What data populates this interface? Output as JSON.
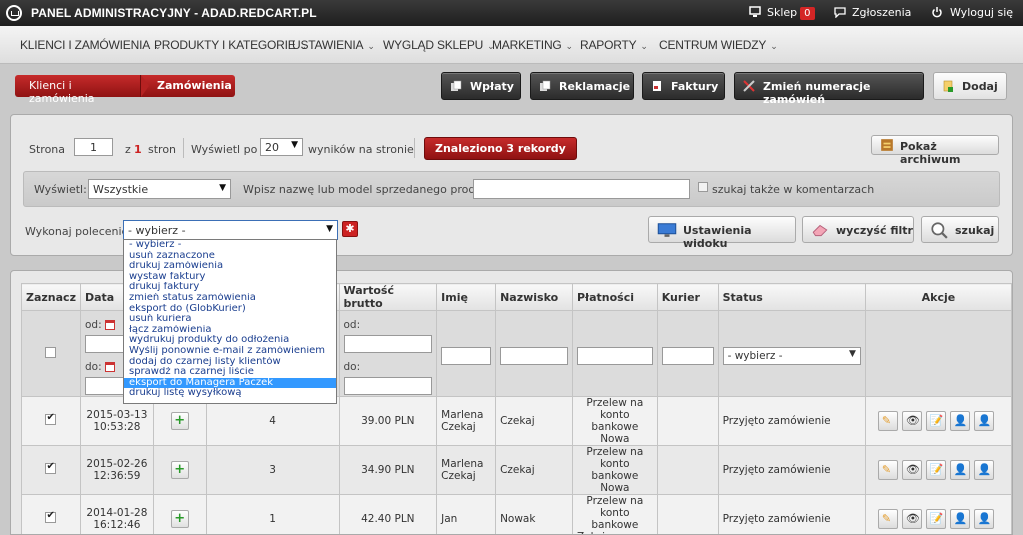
{
  "topbar": {
    "title": "PANEL ADMINISTRACYJNY - ADAD.REDCART.PL",
    "shop_label": "Sklep",
    "shop_badge": "0",
    "reports_label": "Zgłoszenia",
    "logout_label": "Wyloguj się"
  },
  "nav": {
    "items": [
      {
        "label": "KLIENCI I ZAMÓWIENIA"
      },
      {
        "label": "PRODUKTY I KATEGORIE"
      },
      {
        "label": "USTAWIENIA"
      },
      {
        "label": "WYGLĄD SKLEPU"
      },
      {
        "label": "MARKETING"
      },
      {
        "label": "RAPORTY"
      },
      {
        "label": "CENTRUM WIEDZY"
      }
    ]
  },
  "breadcrumb": {
    "parent": "Klienci i zamówienia",
    "current": "Zamówienia"
  },
  "toolbar": {
    "payments": "Wpłaty",
    "complaints": "Reklamacje",
    "invoices": "Faktury",
    "renumber": "Zmień numeracje zamówień",
    "add": "Dodaj"
  },
  "filters": {
    "page_label": "Strona",
    "page_value": "1",
    "of_label": "z",
    "of_total": "1",
    "pages_label": "stron",
    "show_label": "Wyświetl po",
    "show_value": "20",
    "results_label": "wyników na stronie",
    "found_label": "Znaleziono 3 rekordy",
    "archive_label": "Pokaż archiwum",
    "display_label": "Wyświetl:",
    "display_value": "Wszystkie",
    "product_label": "Wpisz nazwę lub model sprzedanego produktu:",
    "product_value": "",
    "comments_label": "szukaj także w komentarzach",
    "command_label": "Wykonaj polecenie:",
    "command_value": "- wybierz -",
    "view_settings": "Ustawienia widoku",
    "clear_filter": "wyczyść filtr",
    "search": "szukaj"
  },
  "command_options": [
    "- wybierz -",
    "usuń zaznaczone",
    "drukuj zamówienia",
    "wystaw faktury",
    "drukuj faktury",
    "zmień status zamówienia",
    "eksport do (GlobKurier)",
    "usuń kuriera",
    "łącz zamówienia",
    "wydrukuj produkty do odłożenia",
    "Wyślij ponownie e-mail z zamówieniem",
    "dodaj do czarnej listy klientów",
    "sprawdź na czarnej liście",
    "eksport do Managera Paczek",
    "drukuj listę wysyłkową"
  ],
  "command_selected_index": 13,
  "table": {
    "headers": {
      "select": "Zaznacz",
      "date": "Data",
      "value": "Wartość brutto",
      "first_name": "Imię",
      "last_name": "Nazwisko",
      "payment": "Płatności",
      "courier": "Kurier",
      "status": "Status",
      "actions": "Akcje"
    },
    "filter": {
      "from_label": "od:",
      "to_label": "do:",
      "status_value": "- wybierz -"
    },
    "rows": [
      {
        "date": "2015-03-13",
        "time": "10:53:28",
        "items": "4",
        "value": "39.00 PLN",
        "first_name": "Marlena Czekaj",
        "last_name": "Czekaj",
        "payment": "Przelew na konto bankowe Nowa",
        "status": "Przyjęto zamówienie"
      },
      {
        "date": "2015-02-26",
        "time": "12:36:59",
        "items": "3",
        "value": "34.90 PLN",
        "first_name": "Marlena Czekaj",
        "last_name": "Czekaj",
        "payment": "Przelew na konto bankowe Nowa",
        "status": "Przyjęto zamówienie"
      },
      {
        "date": "2014-01-28",
        "time": "16:12:46",
        "items": "1",
        "value": "42.40 PLN",
        "first_name": "Jan",
        "last_name": "Nowak",
        "payment": "Przelew na konto bankowe Zaksięgowana",
        "status": "Przyjęto zamówienie"
      }
    ]
  }
}
